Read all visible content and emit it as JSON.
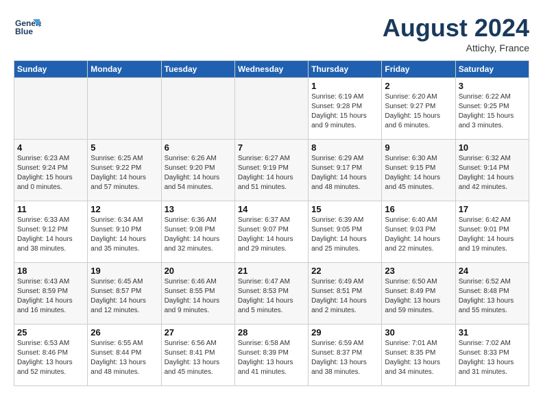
{
  "header": {
    "logo_line1": "General",
    "logo_line2": "Blue",
    "month_year": "August 2024",
    "location": "Attichy, France"
  },
  "days_of_week": [
    "Sunday",
    "Monday",
    "Tuesday",
    "Wednesday",
    "Thursday",
    "Friday",
    "Saturday"
  ],
  "weeks": [
    [
      {
        "day": "",
        "empty": true
      },
      {
        "day": "",
        "empty": true
      },
      {
        "day": "",
        "empty": true
      },
      {
        "day": "",
        "empty": true
      },
      {
        "day": "1",
        "lines": [
          "Sunrise: 6:19 AM",
          "Sunset: 9:28 PM",
          "Daylight: 15 hours",
          "and 9 minutes."
        ]
      },
      {
        "day": "2",
        "lines": [
          "Sunrise: 6:20 AM",
          "Sunset: 9:27 PM",
          "Daylight: 15 hours",
          "and 6 minutes."
        ]
      },
      {
        "day": "3",
        "lines": [
          "Sunrise: 6:22 AM",
          "Sunset: 9:25 PM",
          "Daylight: 15 hours",
          "and 3 minutes."
        ]
      }
    ],
    [
      {
        "day": "4",
        "lines": [
          "Sunrise: 6:23 AM",
          "Sunset: 9:24 PM",
          "Daylight: 15 hours",
          "and 0 minutes."
        ]
      },
      {
        "day": "5",
        "lines": [
          "Sunrise: 6:25 AM",
          "Sunset: 9:22 PM",
          "Daylight: 14 hours",
          "and 57 minutes."
        ]
      },
      {
        "day": "6",
        "lines": [
          "Sunrise: 6:26 AM",
          "Sunset: 9:20 PM",
          "Daylight: 14 hours",
          "and 54 minutes."
        ]
      },
      {
        "day": "7",
        "lines": [
          "Sunrise: 6:27 AM",
          "Sunset: 9:19 PM",
          "Daylight: 14 hours",
          "and 51 minutes."
        ]
      },
      {
        "day": "8",
        "lines": [
          "Sunrise: 6:29 AM",
          "Sunset: 9:17 PM",
          "Daylight: 14 hours",
          "and 48 minutes."
        ]
      },
      {
        "day": "9",
        "lines": [
          "Sunrise: 6:30 AM",
          "Sunset: 9:15 PM",
          "Daylight: 14 hours",
          "and 45 minutes."
        ]
      },
      {
        "day": "10",
        "lines": [
          "Sunrise: 6:32 AM",
          "Sunset: 9:14 PM",
          "Daylight: 14 hours",
          "and 42 minutes."
        ]
      }
    ],
    [
      {
        "day": "11",
        "lines": [
          "Sunrise: 6:33 AM",
          "Sunset: 9:12 PM",
          "Daylight: 14 hours",
          "and 38 minutes."
        ]
      },
      {
        "day": "12",
        "lines": [
          "Sunrise: 6:34 AM",
          "Sunset: 9:10 PM",
          "Daylight: 14 hours",
          "and 35 minutes."
        ]
      },
      {
        "day": "13",
        "lines": [
          "Sunrise: 6:36 AM",
          "Sunset: 9:08 PM",
          "Daylight: 14 hours",
          "and 32 minutes."
        ]
      },
      {
        "day": "14",
        "lines": [
          "Sunrise: 6:37 AM",
          "Sunset: 9:07 PM",
          "Daylight: 14 hours",
          "and 29 minutes."
        ]
      },
      {
        "day": "15",
        "lines": [
          "Sunrise: 6:39 AM",
          "Sunset: 9:05 PM",
          "Daylight: 14 hours",
          "and 25 minutes."
        ]
      },
      {
        "day": "16",
        "lines": [
          "Sunrise: 6:40 AM",
          "Sunset: 9:03 PM",
          "Daylight: 14 hours",
          "and 22 minutes."
        ]
      },
      {
        "day": "17",
        "lines": [
          "Sunrise: 6:42 AM",
          "Sunset: 9:01 PM",
          "Daylight: 14 hours",
          "and 19 minutes."
        ]
      }
    ],
    [
      {
        "day": "18",
        "lines": [
          "Sunrise: 6:43 AM",
          "Sunset: 8:59 PM",
          "Daylight: 14 hours",
          "and 16 minutes."
        ]
      },
      {
        "day": "19",
        "lines": [
          "Sunrise: 6:45 AM",
          "Sunset: 8:57 PM",
          "Daylight: 14 hours",
          "and 12 minutes."
        ]
      },
      {
        "day": "20",
        "lines": [
          "Sunrise: 6:46 AM",
          "Sunset: 8:55 PM",
          "Daylight: 14 hours",
          "and 9 minutes."
        ]
      },
      {
        "day": "21",
        "lines": [
          "Sunrise: 6:47 AM",
          "Sunset: 8:53 PM",
          "Daylight: 14 hours",
          "and 5 minutes."
        ]
      },
      {
        "day": "22",
        "lines": [
          "Sunrise: 6:49 AM",
          "Sunset: 8:51 PM",
          "Daylight: 14 hours",
          "and 2 minutes."
        ]
      },
      {
        "day": "23",
        "lines": [
          "Sunrise: 6:50 AM",
          "Sunset: 8:49 PM",
          "Daylight: 13 hours",
          "and 59 minutes."
        ]
      },
      {
        "day": "24",
        "lines": [
          "Sunrise: 6:52 AM",
          "Sunset: 8:48 PM",
          "Daylight: 13 hours",
          "and 55 minutes."
        ]
      }
    ],
    [
      {
        "day": "25",
        "lines": [
          "Sunrise: 6:53 AM",
          "Sunset: 8:46 PM",
          "Daylight: 13 hours",
          "and 52 minutes."
        ]
      },
      {
        "day": "26",
        "lines": [
          "Sunrise: 6:55 AM",
          "Sunset: 8:44 PM",
          "Daylight: 13 hours",
          "and 48 minutes."
        ]
      },
      {
        "day": "27",
        "lines": [
          "Sunrise: 6:56 AM",
          "Sunset: 8:41 PM",
          "Daylight: 13 hours",
          "and 45 minutes."
        ]
      },
      {
        "day": "28",
        "lines": [
          "Sunrise: 6:58 AM",
          "Sunset: 8:39 PM",
          "Daylight: 13 hours",
          "and 41 minutes."
        ]
      },
      {
        "day": "29",
        "lines": [
          "Sunrise: 6:59 AM",
          "Sunset: 8:37 PM",
          "Daylight: 13 hours",
          "and 38 minutes."
        ]
      },
      {
        "day": "30",
        "lines": [
          "Sunrise: 7:01 AM",
          "Sunset: 8:35 PM",
          "Daylight: 13 hours",
          "and 34 minutes."
        ]
      },
      {
        "day": "31",
        "lines": [
          "Sunrise: 7:02 AM",
          "Sunset: 8:33 PM",
          "Daylight: 13 hours",
          "and 31 minutes."
        ]
      }
    ]
  ]
}
